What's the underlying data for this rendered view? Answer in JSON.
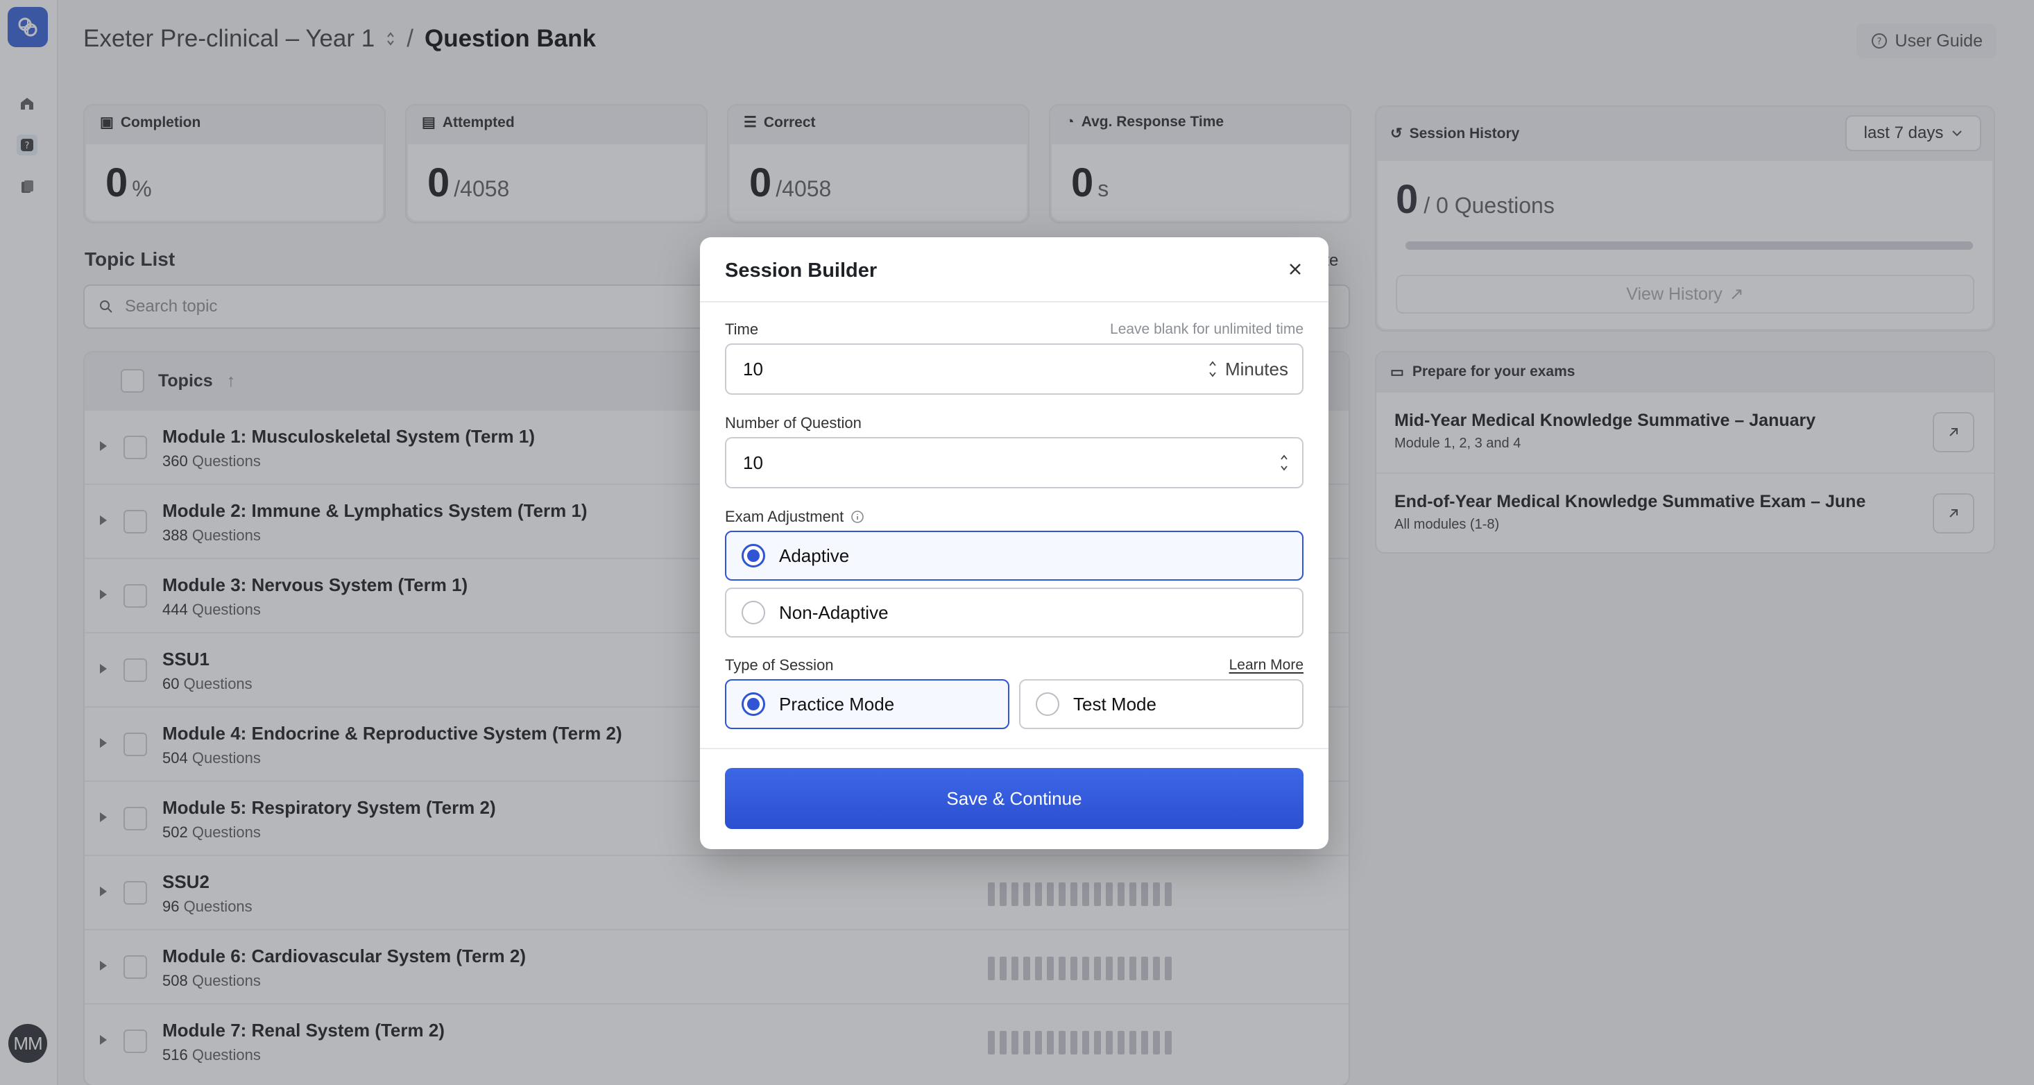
{
  "rail": {
    "avatar_initials": "MM",
    "accent": "#2d5ad6"
  },
  "header": {
    "course": "Exeter Pre-clinical – Year 1",
    "separator": "/",
    "page_title": "Question Bank",
    "user_guide": "User Guide"
  },
  "stats": [
    {
      "label": "Completion",
      "value": "0",
      "unit": "%"
    },
    {
      "label": "Attempted",
      "value": "0",
      "unit": "/4058"
    },
    {
      "label": "Correct",
      "value": "0",
      "unit": "/4058"
    },
    {
      "label": "Avg. Response Time",
      "value": "0",
      "unit": "s"
    }
  ],
  "session_history": {
    "title": "Session History",
    "range": "last 7 days",
    "count": "0",
    "count_suffix": "/ 0 Questions",
    "progress": 0,
    "view_button": "View History"
  },
  "prepare": {
    "title": "Prepare for your exams",
    "exams": [
      {
        "title": "Mid-Year Medical Knowledge Summative – January",
        "subtitle": "Module 1, 2, 3 and 4"
      },
      {
        "title": "End-of-Year Medical Knowledge Summative Exam – June",
        "subtitle": "All modules (1-8)"
      }
    ]
  },
  "topic_list": {
    "title": "Topic List",
    "partial_text": "ete",
    "search_placeholder": "Search topic",
    "column_header": "Topics",
    "questions_word": "Questions",
    "rows": [
      {
        "name": "Module 1: Musculoskeletal System (Term 1)",
        "count": "360"
      },
      {
        "name": "Module 2: Immune & Lymphatics System (Term 1)",
        "count": "388"
      },
      {
        "name": "Module 3: Nervous System (Term 1)",
        "count": "444"
      },
      {
        "name": "SSU1",
        "count": "60"
      },
      {
        "name": "Module 4: Endocrine & Reproductive System (Term 2)",
        "count": "504"
      },
      {
        "name": "Module 5: Respiratory System (Term 2)",
        "count": "502"
      },
      {
        "name": "SSU2",
        "count": "96"
      },
      {
        "name": "Module 6: Cardiovascular System (Term 2)",
        "count": "508"
      },
      {
        "name": "Module 7: Renal System (Term 2)",
        "count": "516"
      }
    ]
  },
  "modal": {
    "title": "Session Builder",
    "time_label": "Time",
    "time_hint": "Leave blank for unlimited time",
    "time_value": "10",
    "time_suffix": "Minutes",
    "questions_label": "Number of Question",
    "questions_value": "10",
    "adjustment_label": "Exam Adjustment",
    "adjustment_options": [
      "Adaptive",
      "Non-Adaptive"
    ],
    "adjustment_selected": "Adaptive",
    "session_type_label": "Type of Session",
    "learn_more": "Learn More",
    "session_type_options": [
      "Practice Mode",
      "Test Mode"
    ],
    "session_type_selected": "Practice Mode",
    "save_button": "Save & Continue",
    "accent": "#2f55d4"
  }
}
